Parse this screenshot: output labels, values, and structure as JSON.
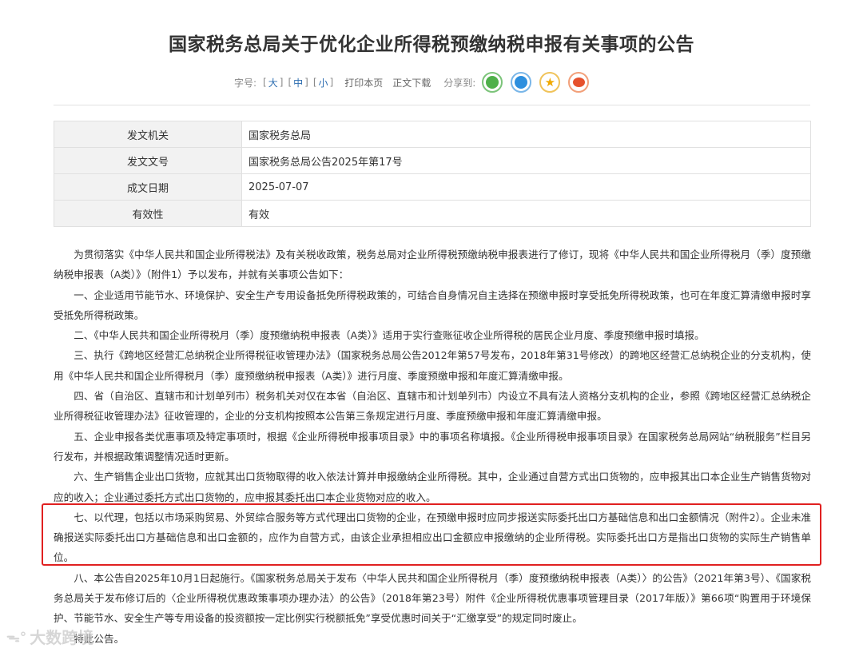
{
  "title": "国家税务总局关于优化企业所得税预缴纳税申报有关事项的公告",
  "toolbar": {
    "font_label": "字号:",
    "size_large": "大",
    "size_medium": "中",
    "size_small": "小",
    "print": "打印本页",
    "download": "正文下载",
    "share_label": "分享到:"
  },
  "share_icons": [
    "wechat-icon",
    "qq-icon",
    "qzone-icon",
    "weibo-icon"
  ],
  "meta": [
    {
      "key": "发文机关",
      "value": "国家税务总局"
    },
    {
      "key": "发文文号",
      "value": "国家税务总局公告2025年第17号"
    },
    {
      "key": "成文日期",
      "value": "2025-07-07"
    },
    {
      "key": "有效性",
      "value": "有效"
    }
  ],
  "paragraphs": [
    "为贯彻落实《中华人民共和国企业所得税法》及有关税收政策，税务总局对企业所得税预缴纳税申报表进行了修订，现将《中华人民共和国企业所得税月（季）度预缴纳税申报表（A类）》（附件1）予以发布，并就有关事项公告如下：",
    "一、企业适用节能节水、环境保护、安全生产专用设备抵免所得税政策的，可结合自身情况自主选择在预缴申报时享受抵免所得税政策，也可在年度汇算清缴申报时享受抵免所得税政策。",
    "二、《中华人民共和国企业所得税月（季）度预缴纳税申报表（A类）》适用于实行查账征收企业所得税的居民企业月度、季度预缴申报时填报。",
    "三、执行《跨地区经营汇总纳税企业所得税征收管理办法》（国家税务总局公告2012年第57号发布，2018年第31号修改）的跨地区经营汇总纳税企业的分支机构，使用《中华人民共和国企业所得税月（季）度预缴纳税申报表（A类）》进行月度、季度预缴申报和年度汇算清缴申报。",
    "四、省（自治区、直辖市和计划单列市）税务机关对仅在本省（自治区、直辖市和计划单列市）内设立不具有法人资格分支机构的企业，参照《跨地区经营汇总纳税企业所得税征收管理办法》征收管理的，企业的分支机构按照本公告第三条规定进行月度、季度预缴申报和年度汇算清缴申报。",
    "五、企业申报各类优惠事项及特定事项时，根据《企业所得税申报事项目录》中的事项名称填报。《企业所得税申报事项目录》在国家税务总局网站“纳税服务”栏目另行发布，并根据政策调整情况适时更新。",
    "六、生产销售企业出口货物，应就其出口货物取得的收入依法计算并申报缴纳企业所得税。其中，企业通过自营方式出口货物的，应申报其出口本企业生产销售货物对应的收入；企业通过委托方式出口货物的，应申报其委托出口本企业货物对应的收入。",
    "七、以代理，包括以市场采购贸易、外贸综合服务等方式代理出口货物的企业，在预缴申报时应同步报送实际委托出口方基础信息和出口金额情况（附件2）。企业未准确报送实际委托出口方基础信息和出口金额的，应作为自营方式，由该企业承担相应出口金额应申报缴纳的企业所得税。实际委托出口方是指出口货物的实际生产销售单位。",
    "八、本公告自2025年10月1日起施行。《国家税务总局关于发布〈中华人民共和国企业所得税月（季）度预缴纳税申报表（A类）〉的公告》（2021年第3号）、《国家税务总局关于发布修订后的〈企业所得税优惠政策事项办理办法〉的公告》（2018年第23号）附件《企业所得税优惠事项管理目录（2017年版）》第66项“购置用于环境保护、节能节水、安全生产等专用设备的投资额按一定比例实行税额抵免”享受优惠时间关于“汇缴享受”的规定同时废止。",
    "特此公告。"
  ],
  "watermark": "大数跨境"
}
